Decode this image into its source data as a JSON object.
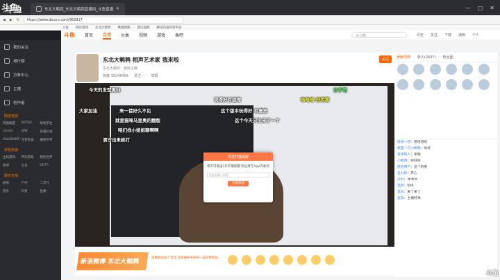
{
  "browser": {
    "logo": "斗鱼",
    "logo_sub": "douyutv.com",
    "tab_title": "东北大鹌鹑_东北大鹌鹑直播间_斗鱼直播",
    "url": "https://www.douyu.com/962917",
    "bookmarks": [
      "斗鱼",
      "网页游戏",
      "东北大鹌鹑",
      "鹰眼网络",
      "西瓜视频",
      "腾讯内容开放平台"
    ]
  },
  "topnav": {
    "logo": "斗鱼",
    "items": [
      "首页",
      "直播",
      "分类",
      "视频",
      "游戏",
      "鱼吧"
    ],
    "active": "直播",
    "search_placeholder": "大小鹅",
    "icons": [
      "历史",
      "关注",
      "下载",
      "通知",
      "个人"
    ]
  },
  "sidebar": {
    "items": [
      "我的关注",
      "排行榜",
      "万象中心",
      "主播",
      "创作者"
    ],
    "section1": "网游竞技",
    "games1": [
      "英雄联盟",
      "DOTA2",
      "绝地求生",
      "CS:GO",
      "DNF",
      "穿越火线",
      "VALORANT",
      "守望先锋",
      "魔兽世界"
    ],
    "section2": "单机热游",
    "games2": [
      "主机游戏",
      "怀旧游戏",
      "我的世界",
      "原神",
      "方舟",
      "DOTA"
    ],
    "section3": "娱乐天地",
    "games3": [
      "颜值",
      "户外",
      "二次元",
      "音乐",
      "科技",
      "鱼教"
    ]
  },
  "room": {
    "title": "东北大鹌鹑 相声艺术家 我来啦",
    "tag": "东北大鹌鹑 · 游戏主播",
    "meta": [
      "热度 15246496",
      "关注 ⋯",
      "举报"
    ],
    "follow_label": "关注"
  },
  "danmaku": [
    {
      "text": "今天的发型真帅",
      "color": ""
    },
    {
      "text": "说得好有道理",
      "color": ""
    },
    {
      "text": "哈哈哈 好厉害",
      "color": "y"
    },
    {
      "text": "分手吧",
      "color": "g"
    },
    {
      "text": "大家加油",
      "color": ""
    },
    {
      "text": "来一首好久不见",
      "color": ""
    },
    {
      "text": "这个版本玩得好 有意思",
      "color": ""
    },
    {
      "text": "就是猫咪马里奥的翻版",
      "color": ""
    },
    {
      "text": "咱们找小姐姐聊啊啊",
      "color": ""
    },
    {
      "text": "这个今天只出来了一个",
      "color": ""
    },
    {
      "text": "清汐出来挨打",
      "color": ""
    }
  ],
  "dialog": {
    "title": "发送开播提醒",
    "body": "每天可发送1条开播提醒 粉丝将在App内收到",
    "input_placeholder": "在此处输入内容",
    "button": "立即发送"
  },
  "giftbar": {
    "promo": "新浪微博 东北大鹌鹑",
    "notice": "主播也会这个活动 可在抽奖中获得一些礼物奖励"
  },
  "rank": {
    "tabs": [
      "贡献周榜",
      "新人(2697)",
      "粉丝团"
    ],
    "active": "贡献周榜"
  },
  "chat": [
    {
      "user": "哈哈一鸽",
      "msg": "哈哈哈哈"
    },
    {
      "user": "我是一只小鹌鹑",
      "msg": "你好"
    },
    {
      "user": "等待的人",
      "msg": "来啦"
    },
    {
      "user": "小鹌鹑",
      "msg": "好好好"
    },
    {
      "user": "匿名用户",
      "msg": "这个厉害"
    },
    {
      "user": "鱼丸粉",
      "msg": "开心"
    },
    {
      "user": "白丸",
      "msg": "冲冲冲"
    },
    {
      "user": "追梦",
      "msg": "666"
    },
    {
      "user": "黑白",
      "msg": "来了来了"
    },
    {
      "user": "鱼友",
      "msg": "主播好帅"
    }
  ],
  "watermark": {
    "top": "斗鱼",
    "bottom": "斗鱼"
  }
}
